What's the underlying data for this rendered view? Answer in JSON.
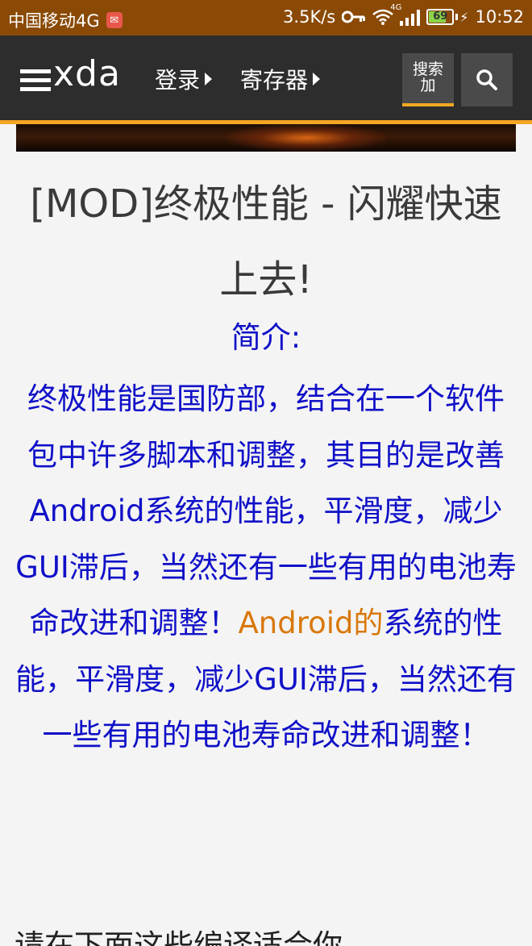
{
  "status_bar": {
    "carrier": "中国移动4G",
    "speed": "3.5K/s",
    "net_type": "4G",
    "battery": "69",
    "time": "10:52",
    "icons": [
      "app-notification-icon",
      "key-icon",
      "wifi-icon",
      "signal-icon",
      "battery-icon",
      "charging-icon"
    ]
  },
  "header": {
    "logo": "xda",
    "nav_login": "登录",
    "nav_register": "寄存器",
    "search_button_line1": "搜索",
    "search_button_line2": "加"
  },
  "article": {
    "title": "[MOD]终极性能 - 闪耀快速上去!",
    "intro_heading": "简介:",
    "body_part1": "终极性能是国防部，结合在一个软件包中许多脚本和调整，其目的是改善Android系统的性能，平滑度，减少GUI滞后，当然还有一些有用的电池寿命改进和调整！",
    "body_highlight": "Android的",
    "body_part2": "系统的性能，平滑度，减少GUI滞后，当然还有一些有用的电池寿命改进和调整！",
    "next_line_partial": "请在下面这些编译适合你"
  },
  "colors": {
    "status_bar": "#8a4a06",
    "header_bg": "#2d2d2d",
    "accent": "#f5a623",
    "body_text": "#1010c8",
    "highlight": "#d8780a"
  }
}
